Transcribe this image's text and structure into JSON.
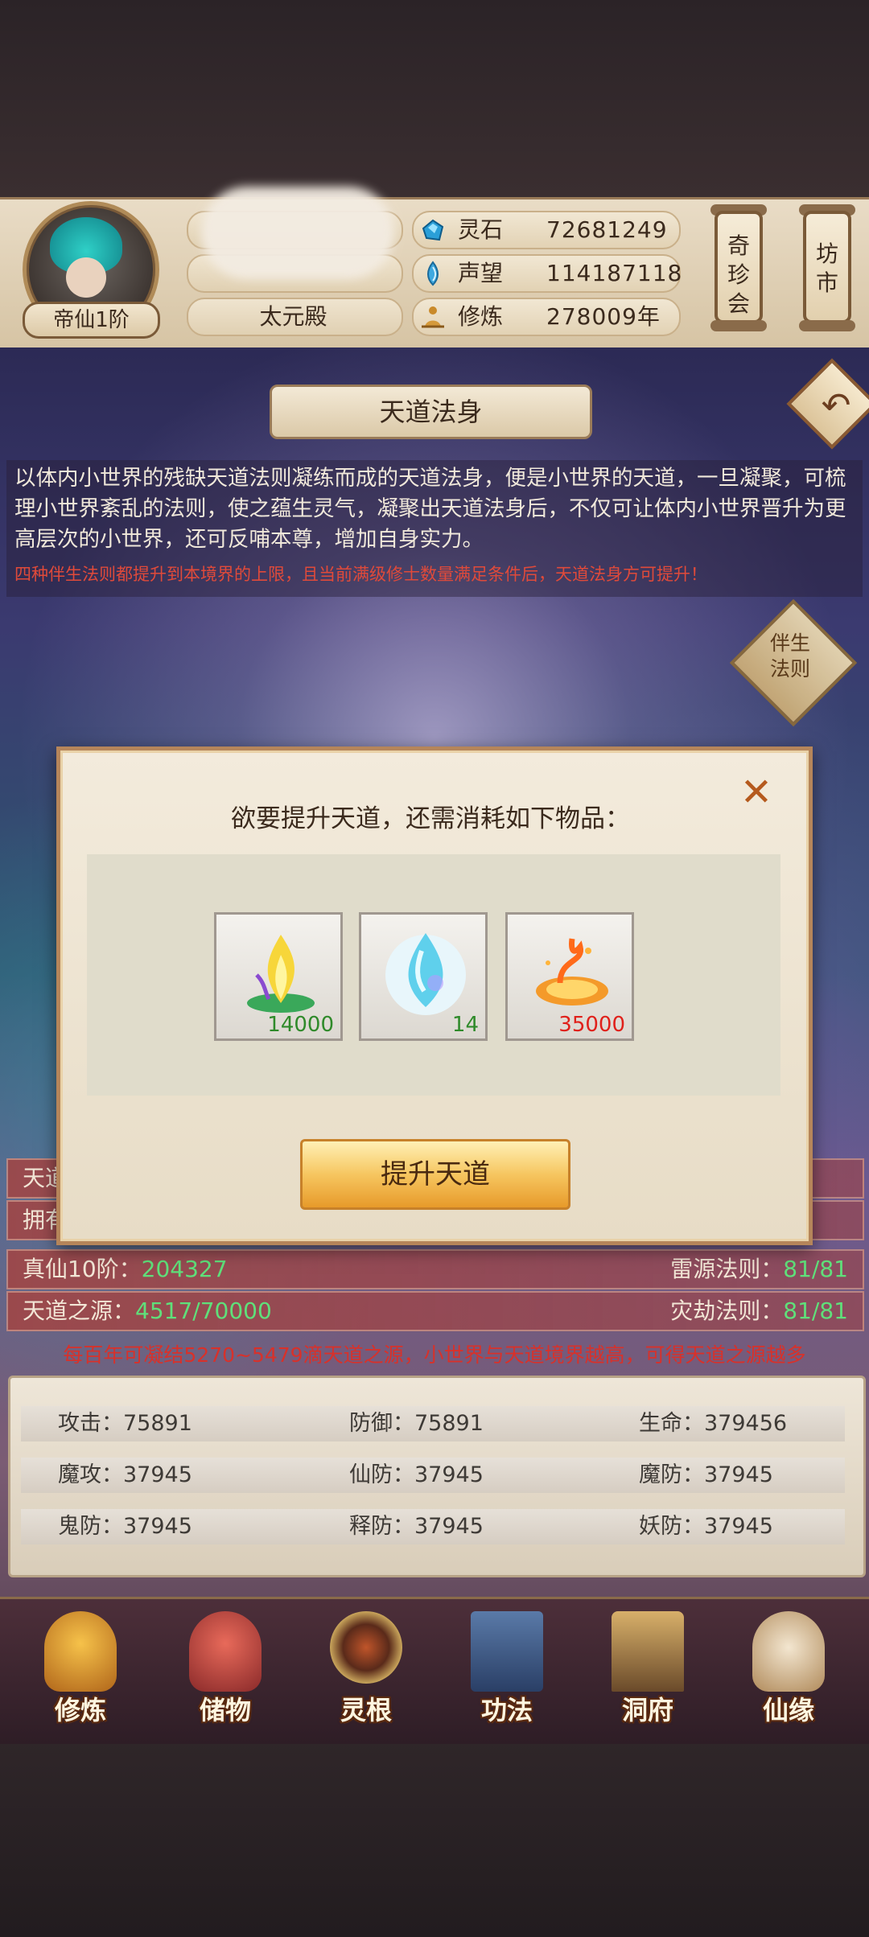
{
  "header": {
    "rank_tag": "帝仙1阶",
    "sect_name": "太元殿",
    "stats": [
      {
        "label": "灵石",
        "value": "72681249",
        "icon": "spirit-stone-icon"
      },
      {
        "label": "声望",
        "value": "114187118",
        "icon": "reputation-icon"
      },
      {
        "label": "修炼",
        "value": "278009年",
        "icon": "meditation-icon"
      }
    ],
    "side_buttons": [
      {
        "label": "奇珍会"
      },
      {
        "label": "坊市"
      }
    ]
  },
  "page": {
    "title": "天道法身",
    "description": "以体内小世界的残缺天道法则凝练而成的天道法身，便是小世界的天道，一旦凝聚，可梳理小世界紊乱的法则，使之蕴生灵气，凝聚出天道法身后，不仅可让体内小世界晋升为更高层次的小世界，还可反哺本尊，增加自身实力。",
    "warning": "四种伴生法则都提升到本境界的上限，且当前满级修士数量满足条件后，天道法身方可提升！",
    "law_button": "伴生法则"
  },
  "info_rows": [
    {
      "left_label": "天道",
      "left_value": "",
      "right_label": "",
      "right_value": ""
    },
    {
      "left_label": "拥有",
      "left_value": "",
      "right_label": "",
      "right_value": ""
    },
    {
      "left_label": "真仙10阶：",
      "left_value": "204327",
      "right_label": "雷源法则：",
      "right_value": "81/81"
    },
    {
      "left_label": "天道之源：",
      "left_value": "4517/70000",
      "right_label": "灾劫法则：",
      "right_value": "81/81"
    }
  ],
  "gather_note": "每百年可凝结5270~5479滴天道之源，小世界与天道境界越高，可得天道之源越多",
  "attributes": [
    [
      "攻击：75891",
      "防御：75891",
      "生命：379456"
    ],
    [
      "魔攻：37945",
      "仙防：37945",
      "魔防：37945"
    ],
    [
      "鬼防：37945",
      "释防：37945",
      "妖防：37945"
    ]
  ],
  "nav": [
    {
      "label": "修炼",
      "icon": "cultivate-icon"
    },
    {
      "label": "储物",
      "icon": "storage-bag-icon"
    },
    {
      "label": "灵根",
      "icon": "spirit-root-icon"
    },
    {
      "label": "功法",
      "icon": "technique-book-icon"
    },
    {
      "label": "洞府",
      "icon": "cave-palace-icon"
    },
    {
      "label": "仙缘",
      "icon": "immortal-fate-icon"
    }
  ],
  "modal": {
    "title": "欲要提升天道，还需消耗如下物品：",
    "close": "✕",
    "items": [
      {
        "count": "14000",
        "count_color": "#2f8a2a",
        "icon": "golden-flame-item-icon"
      },
      {
        "count": "14",
        "count_color": "#2f8a2a",
        "icon": "water-drop-item-icon"
      },
      {
        "count": "35000",
        "count_color": "#e0201a",
        "icon": "fire-vortex-item-icon"
      }
    ],
    "button": "提升天道"
  }
}
